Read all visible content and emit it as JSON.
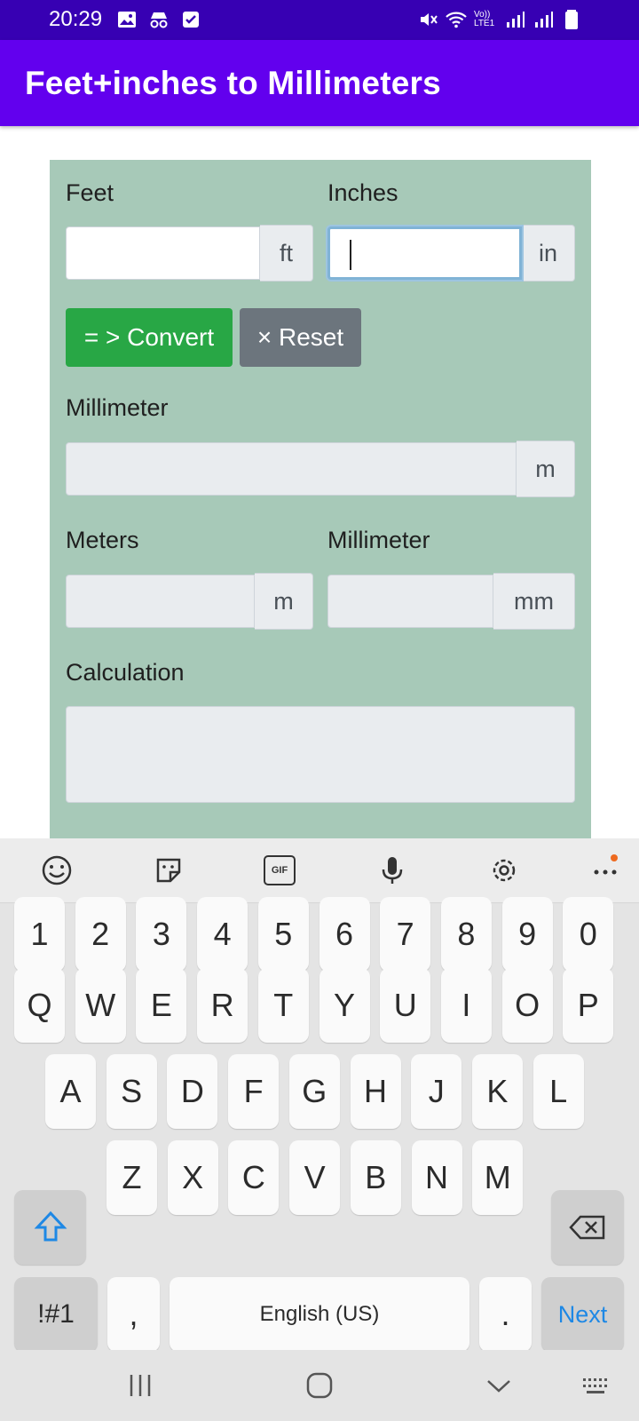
{
  "status_bar": {
    "time": "20:29",
    "left_icons": [
      "gallery-icon",
      "incognito-icon",
      "checkbox-notification-icon"
    ],
    "right_icons": [
      "mute-icon",
      "wifi-icon",
      "volte-icon",
      "signal-icon",
      "signal-icon",
      "battery-icon"
    ],
    "volte_label": "Vo)) LTE1"
  },
  "app_bar": {
    "title": "Feet+inches to Millimeters"
  },
  "form": {
    "feet_label": "Feet",
    "feet_unit": "ft",
    "feet_value": "",
    "inches_label": "Inches",
    "inches_unit": "in",
    "inches_value": "",
    "convert_label": "= > Convert",
    "reset_label": "× Reset",
    "millimeter_label": "Millimeter",
    "millimeter_unit": "m",
    "meters_label": "Meters",
    "meters_unit": "m",
    "millimeter2_label": "Millimeter",
    "millimeter2_unit": "mm",
    "calculation_label": "Calculation"
  },
  "keyboard": {
    "toolbar_icons": [
      "emoji-icon",
      "sticker-icon",
      "gif-icon",
      "microphone-icon",
      "settings-icon",
      "more-icon"
    ],
    "number_row": [
      "1",
      "2",
      "3",
      "4",
      "5",
      "6",
      "7",
      "8",
      "9",
      "0"
    ],
    "row1": [
      "Q",
      "W",
      "E",
      "R",
      "T",
      "Y",
      "U",
      "I",
      "O",
      "P"
    ],
    "row2": [
      "A",
      "S",
      "D",
      "F",
      "G",
      "H",
      "J",
      "K",
      "L"
    ],
    "row3": [
      "Z",
      "X",
      "C",
      "V",
      "B",
      "N",
      "M"
    ],
    "symbols_key": "!#1",
    "comma_key": ",",
    "space_label": "English (US)",
    "period_key": ".",
    "next_key": "Next",
    "gif_label": "GIF"
  },
  "navbar": {
    "icons": [
      "recents-icon",
      "home-icon",
      "back-icon",
      "keyboard-icon"
    ]
  }
}
